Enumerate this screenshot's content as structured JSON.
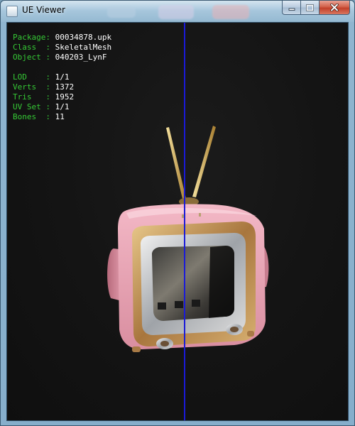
{
  "window": {
    "title": "UE Viewer"
  },
  "info_panel": {
    "rows_group1": [
      {
        "key": "Package",
        "sep": ": ",
        "value": "00034878.upk"
      },
      {
        "key": "Class  ",
        "sep": ": ",
        "value": "SkeletalMesh"
      },
      {
        "key": "Object ",
        "sep": ": ",
        "value": "040203_LynF"
      }
    ],
    "rows_group2": [
      {
        "key": "LOD    ",
        "sep": ": ",
        "value": "1/1"
      },
      {
        "key": "Verts  ",
        "sep": ": ",
        "value": "1372"
      },
      {
        "key": "Tris   ",
        "sep": ": ",
        "value": "1952"
      },
      {
        "key": "UV Set ",
        "sep": ": ",
        "value": "1/1"
      },
      {
        "key": "Bones  ",
        "sep": ": ",
        "value": "11"
      }
    ]
  },
  "colors": {
    "info_key": "#35c935",
    "info_value": "#ffffff",
    "axis": "#1a1ad8",
    "viewport_bg": "#141414"
  },
  "icons": {
    "app": "app-icon",
    "minimize": "minimize-icon",
    "maximize": "maximize-icon",
    "close": "close-icon"
  }
}
